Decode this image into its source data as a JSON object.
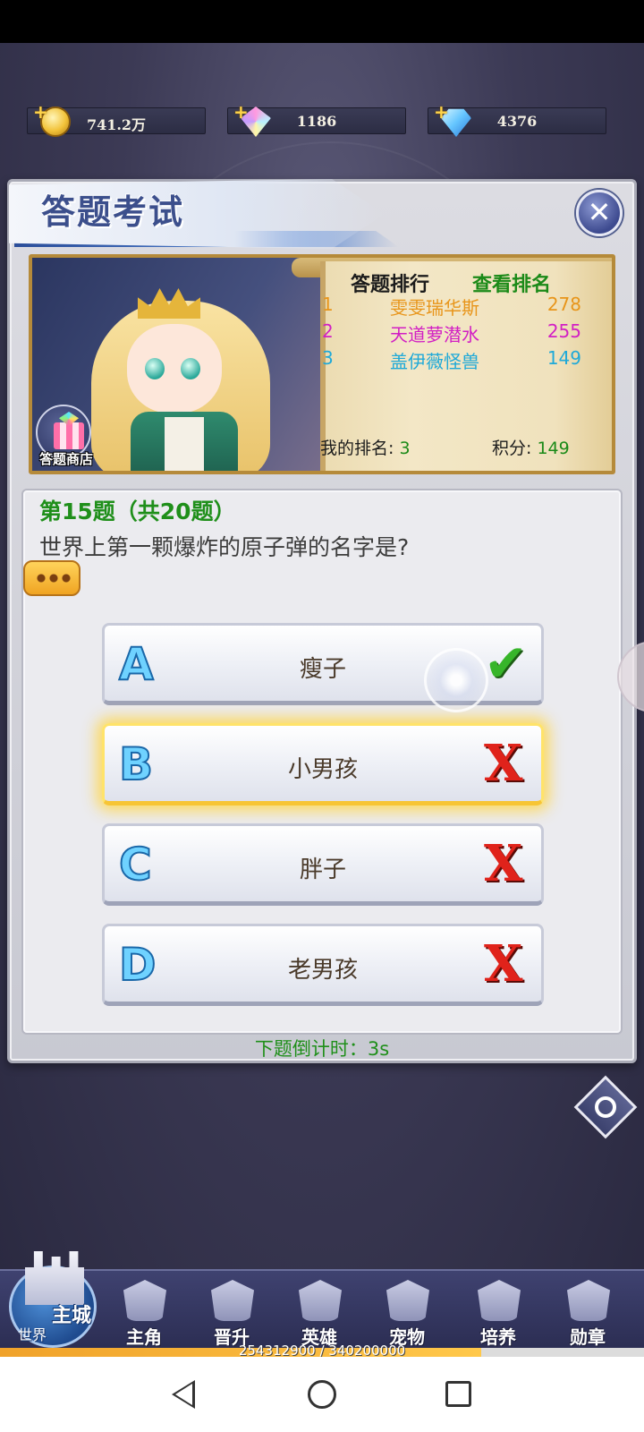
{
  "resources": [
    {
      "icon": "gold-coin-icon",
      "value": "741.2万"
    },
    {
      "icon": "rainbow-gem-icon",
      "value": "1186"
    },
    {
      "icon": "blue-diamond-icon",
      "value": "4376"
    }
  ],
  "panel": {
    "title": "答题考试",
    "close_icon": "close-icon"
  },
  "banner": {
    "shop_label": "答题商店",
    "ranking": {
      "header": "答题排行",
      "view_link": "查看排名",
      "entries": [
        {
          "rank": "1",
          "name": "雯雯瑞华斯",
          "score": "278",
          "color": "#e8951a"
        },
        {
          "rank": "2",
          "name": "天道萝潜水",
          "score": "255",
          "color": "#d21fc4"
        },
        {
          "rank": "3",
          "name": "盖伊薇怪兽",
          "score": "149",
          "color": "#1fa9d8"
        }
      ],
      "my_rank_label": "我的排名:",
      "my_rank_value": "3",
      "my_score_label": "积分:",
      "my_score_value": "149"
    }
  },
  "question": {
    "number": "第15题（共20题）",
    "text": "世界上第一颗爆炸的原子弹的名字是?",
    "options": [
      {
        "letter": "A",
        "text": "瘦子",
        "result": "correct"
      },
      {
        "letter": "B",
        "text": "小男孩",
        "result": "wrong",
        "selected": true
      },
      {
        "letter": "C",
        "text": "胖子",
        "result": "wrong"
      },
      {
        "letter": "D",
        "text": "老男孩",
        "result": "wrong"
      }
    ],
    "countdown": "下题倒计时：3s"
  },
  "nav": {
    "main_city": "主城",
    "world": "世界",
    "items": [
      "主角",
      "晋升",
      "英雄",
      "宠物",
      "培养",
      "勋章"
    ]
  },
  "experience": {
    "text": "254312900 / 340200000",
    "progress": 0.7475
  },
  "colors": {
    "accent_green": "#1f8f1a",
    "correct": "#37b52a",
    "wrong": "#e0231b",
    "selected_glow": "#ffd646"
  }
}
